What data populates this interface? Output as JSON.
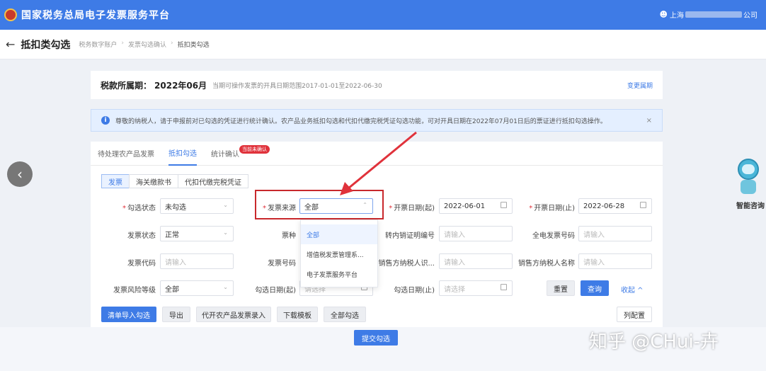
{
  "topbar": {
    "title": "国家税务总局电子发票服务平台",
    "user_prefix": "上海",
    "user_suffix": "公司"
  },
  "subheader": {
    "page_title": "抵扣类勾选",
    "crumbs": [
      "税务数字账户",
      "发票勾选确认",
      "抵扣类勾选"
    ]
  },
  "period": {
    "label": "税款所属期：",
    "value": "2022年06月",
    "hint": "当期可操作发票的开具日期范围2017-01-01至2022-06-30",
    "link": "变更属期"
  },
  "notice": {
    "text": "尊敬的纳税人，请于申报前对已勾选的凭证进行统计确认。农产品业务抵扣勾选和代扣代缴完税凭证勾选功能，可对开具日期在2022年07月01日后的票证进行抵扣勾选操作。",
    "close": "×"
  },
  "tabs": {
    "items": [
      "待处理农产品发票",
      "抵扣勾选",
      "统计确认"
    ],
    "badge": "当前未确认"
  },
  "subtabs": [
    "发票",
    "海关缴款书",
    "代扣代缴完税凭证"
  ],
  "form": {
    "check_status": {
      "label": "勾选状态",
      "value": "未勾选"
    },
    "invoice_source": {
      "label": "发票来源",
      "value": "全部"
    },
    "issue_date_start": {
      "label": "开票日期(起)",
      "value": "2022-06-01"
    },
    "issue_date_end": {
      "label": "开票日期(止)",
      "value": "2022-06-28"
    },
    "invoice_status": {
      "label": "发票状态",
      "value": "正常"
    },
    "invoice_type": {
      "label": "票种"
    },
    "transfer_no": {
      "label": "转内销证明编号",
      "placeholder": "请输入"
    },
    "einvoice_no": {
      "label": "全电发票号码",
      "placeholder": "请输入"
    },
    "invoice_code": {
      "label": "发票代码",
      "placeholder": "请输入"
    },
    "invoice_no": {
      "label": "发票号码"
    },
    "seller_taxid": {
      "label": "销售方纳税人识...",
      "placeholder": "请输入"
    },
    "seller_name": {
      "label": "销售方纳税人名称",
      "placeholder": "请输入"
    },
    "risk_level": {
      "label": "发票风险等级",
      "value": "全部"
    },
    "check_date_start": {
      "label": "勾选日期(起)",
      "placeholder": "请选择"
    },
    "check_date_end": {
      "label": "勾选日期(止)",
      "placeholder": "请选择"
    }
  },
  "dropdown": {
    "options": [
      "全部",
      "增值税发票管理系...",
      "电子发票服务平台"
    ]
  },
  "buttons": {
    "reset": "重置",
    "query": "查询",
    "collapse": "收起 ^",
    "import": "清单导入勾选",
    "export": "导出",
    "agri_entry": "代开农产品发票录入",
    "template": "下载模板",
    "select_all": "全部勾选",
    "columns": "列配置",
    "submit": "提交勾选"
  },
  "robot_label": "智能咨询",
  "watermark": "知乎 @CHui-卉",
  "colors": {
    "primary": "#3e7be6",
    "highlight": "#c8282c",
    "arrow": "#e0323b"
  }
}
